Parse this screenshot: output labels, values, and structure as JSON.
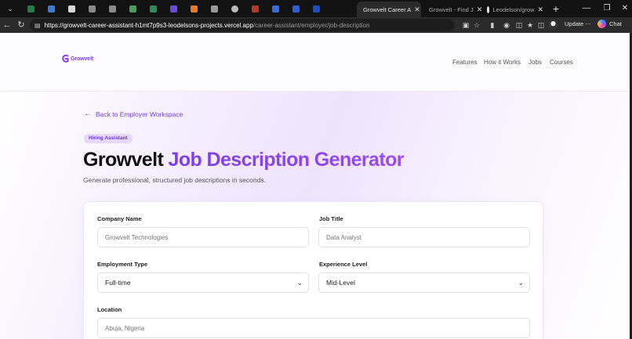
{
  "browser": {
    "active_tab": {
      "title": "Growvelt Career A"
    },
    "other_tabs": [
      {
        "title": "Growvelt - Find J"
      },
      {
        "title": "Leodelson/grow"
      }
    ],
    "url_host": "https://growvelt-career-assistant-h1mt7p9s3-leodelsons-projects.vercel.app",
    "url_path": "/career-assistant/employer/job-description",
    "update_label": "Update",
    "chat_label": "Chat"
  },
  "header": {
    "logo_text": "Growvelt",
    "nav": [
      "Features",
      "How it Works",
      "Jobs",
      "Courses"
    ]
  },
  "hero": {
    "back_link": "Back to Employer Workspace",
    "badge": "Hiring Assistant",
    "title_part1": "Growvelt",
    "title_part2": "Job Description Generator",
    "subtitle": "Generate professional, structured job descriptions in seconds."
  },
  "form": {
    "company_name": {
      "label": "Company Name",
      "placeholder": "Growvelt Technologies"
    },
    "job_title": {
      "label": "Job Title",
      "placeholder": "Data Analyst"
    },
    "employment_type": {
      "label": "Employment Type",
      "value": "Full-time"
    },
    "experience_level": {
      "label": "Experience Level",
      "value": "Mid-Level"
    },
    "location": {
      "label": "Location",
      "placeholder": "Abuja, Nigeria"
    }
  },
  "colors": {
    "brand": "#7b3fe4",
    "title_gradient_start": "#7a3ee9",
    "title_gradient_end": "#9b4bf2",
    "badge_bg": "#e7d8fb"
  }
}
